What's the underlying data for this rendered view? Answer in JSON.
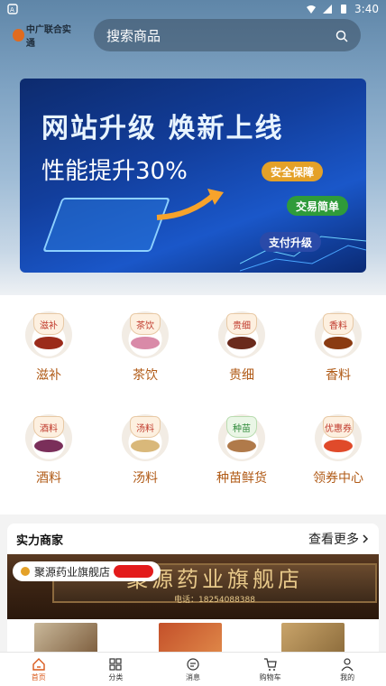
{
  "status_bar": {
    "time": "3:40"
  },
  "logo": {
    "text": "中广联合实通"
  },
  "search": {
    "placeholder": "搜索商品"
  },
  "banner": {
    "title": "网站升级 焕新上线",
    "subtitle": "性能提升30%",
    "pills": [
      "安全保障",
      "交易简单",
      "支付升级"
    ]
  },
  "categories": [
    {
      "tag": "滋补",
      "label": "滋补"
    },
    {
      "tag": "茶饮",
      "label": "茶饮"
    },
    {
      "tag": "贵细",
      "label": "贵细"
    },
    {
      "tag": "香料",
      "label": "香料"
    },
    {
      "tag": "酒料",
      "label": "酒料"
    },
    {
      "tag": "汤料",
      "label": "汤料"
    },
    {
      "tag": "种苗",
      "label": "种苗鲜货"
    },
    {
      "tag": "优惠券",
      "label": "领券中心"
    }
  ],
  "store": {
    "section_title": "实力商家",
    "more_label": "查看更多",
    "shop_name": "聚源药业旗舰店",
    "sign_text": "聚源药业旗舰店",
    "sign_phone": "电话：18254088388"
  },
  "tabbar": {
    "items": [
      {
        "label": "首页",
        "icon": "home-icon"
      },
      {
        "label": "分类",
        "icon": "grid-icon"
      },
      {
        "label": "消息",
        "icon": "message-icon"
      },
      {
        "label": "购物车",
        "icon": "cart-icon"
      },
      {
        "label": "我的",
        "icon": "user-icon"
      }
    ]
  },
  "colors": {
    "accent": "#d9581a",
    "category_label": "#b05a16"
  }
}
